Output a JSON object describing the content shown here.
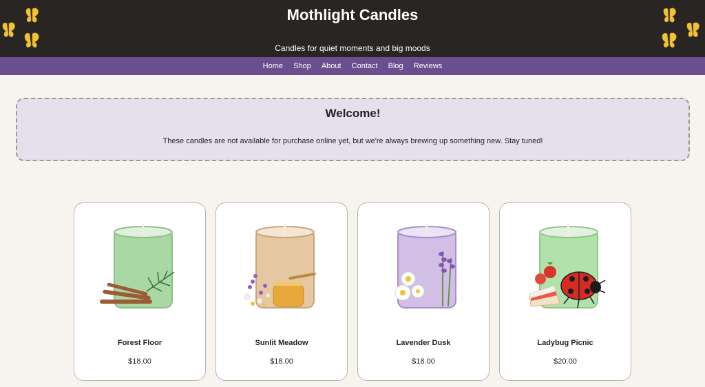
{
  "header": {
    "title": "Mothlight Candles",
    "tagline": "Candles for quiet moments and big moods"
  },
  "nav": {
    "items": [
      "Home",
      "Shop",
      "About",
      "Contact",
      "Blog",
      "Reviews"
    ]
  },
  "welcome": {
    "heading": "Welcome!",
    "message": "These candles are not available for purchase online yet, but we're always brewing up something new. Stay tuned!"
  },
  "products": [
    {
      "name": "Forest Floor",
      "price": "$18.00",
      "jar_color": "#a9d8a5",
      "garnish": "pine-cinnamon"
    },
    {
      "name": "Sunlit Meadow",
      "price": "$18.00",
      "jar_color": "#e5c7a2",
      "garnish": "wildflowers-honey"
    },
    {
      "name": "Lavender Dusk",
      "price": "$18.00",
      "jar_color": "#d1bfe6",
      "garnish": "lavender-daisy"
    },
    {
      "name": "Ladybug Picnic",
      "price": "$20.00",
      "jar_color": "#b3e1ac",
      "garnish": "ladybug-strawberry"
    }
  ],
  "colors": {
    "header_bg": "#282523",
    "nav_bg": "#6a4e8e",
    "welcome_bg": "#e6e0ed",
    "page_bg": "#f7f4ef",
    "butterfly": "#f2c335"
  },
  "icons": {
    "decor_left": "butterflies-icon",
    "decor_right": "butterflies-icon"
  }
}
